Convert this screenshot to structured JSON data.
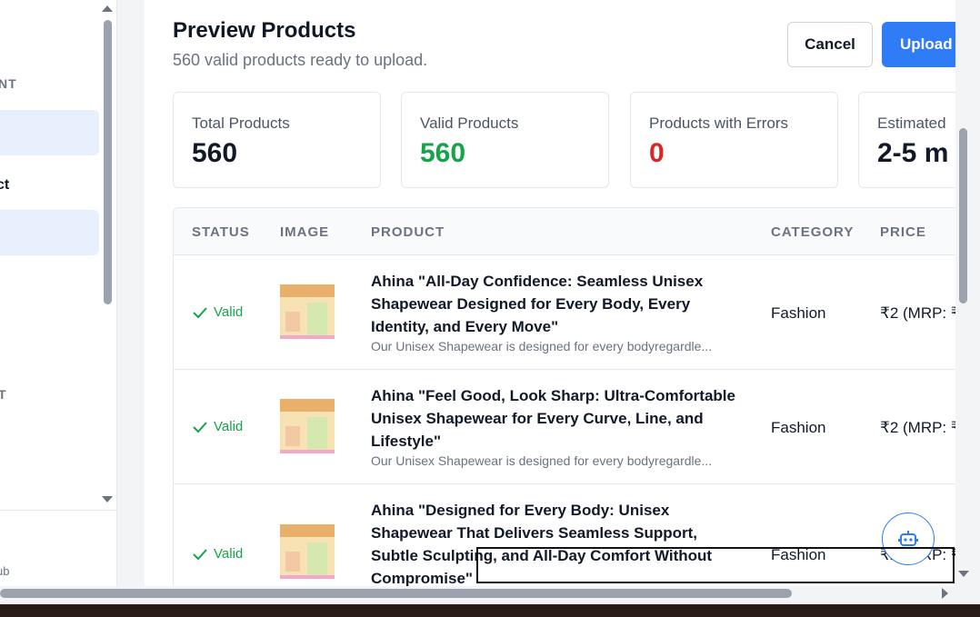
{
  "sidebar": {
    "section_1": "NT",
    "item_1": "ct",
    "section_2": "T",
    "footer": "ub"
  },
  "modal": {
    "title": "Preview Products",
    "subtitle": "560 valid products ready to upload.",
    "cancel_label": "Cancel",
    "upload_label": "Upload"
  },
  "stats": [
    {
      "label": "Total Products",
      "value": "560",
      "color": "#111827"
    },
    {
      "label": "Valid Products",
      "value": "560",
      "color": "#16a34a"
    },
    {
      "label": "Products with Errors",
      "value": "0",
      "color": "#dc2626"
    },
    {
      "label": "Estimated",
      "value": "2-5 m",
      "color": "#111827"
    }
  ],
  "table": {
    "headers": {
      "status": "STATUS",
      "image": "IMAGE",
      "product": "PRODUCT",
      "category": "CATEGORY",
      "price": "PRICE"
    },
    "rows": [
      {
        "status": "Valid",
        "name": "Ahina \"All-Day Confidence: Seamless Unisex Shapewear Designed for Every Body, Every Identity, and Every Move\"",
        "description": "Our Unisex Shapewear is designed for every bodyregardle...",
        "category": "Fashion",
        "price": "₹2 (MRP: ₹"
      },
      {
        "status": "Valid",
        "name": "Ahina \"Feel Good, Look Sharp: Ultra-Comfortable Unisex Shapewear for Every Curve, Line, and Lifestyle\"",
        "description": "Our Unisex Shapewear is designed for every bodyregardle...",
        "category": "Fashion",
        "price": "₹2 (MRP: ₹"
      },
      {
        "status": "Valid",
        "name": "Ahina \"Designed for Every Body: Unisex Shapewear That Delivers Seamless Support, Subtle Sculpting, and All-Day Comfort Without Compromise\"",
        "description": "",
        "category": "Fashion",
        "price": "₹2 (MRP: ₹"
      }
    ]
  },
  "colors": {
    "accent": "#2f7cf6",
    "valid": "#16a34a",
    "error": "#dc2626"
  },
  "icons": {
    "status_valid": "check-icon",
    "assistant": "robot-icon"
  }
}
